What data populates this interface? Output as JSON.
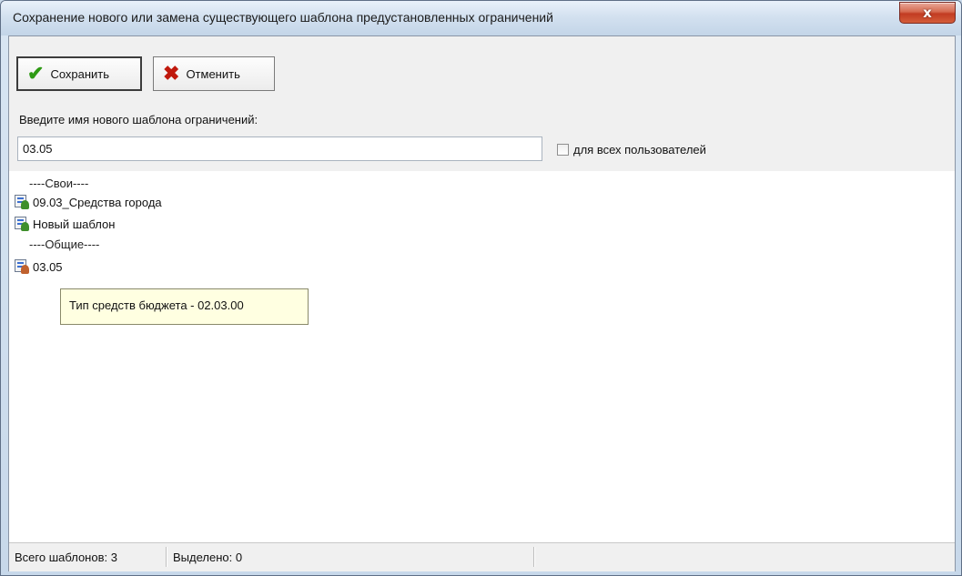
{
  "window": {
    "title": "Сохранение нового или замена существующего шаблона предустановленных ограничений",
    "close_label": "x"
  },
  "toolbar": {
    "save_label": "Сохранить",
    "cancel_label": "Отменить"
  },
  "form": {
    "prompt": "Введите имя нового шаблона ограничений:",
    "name_value": "03.05",
    "all_users_label": "для всех пользователей",
    "all_users_checked": false
  },
  "tree": {
    "own_header": "----Свои----",
    "own_items": [
      "09.03_Средства города",
      "Новый шаблон"
    ],
    "shared_header": "----Общие----",
    "shared_items": [
      "03.05"
    ]
  },
  "tooltip": {
    "text": "Тип средств бюджета  -  02.03.00"
  },
  "status": {
    "total": "Всего шаблонов: 3",
    "selected": "Выделено: 0"
  },
  "colors": {
    "accent_check": "#2e9a14",
    "accent_cross": "#c0190d",
    "close_red": "#c23b22",
    "tooltip_bg": "#ffffe1"
  }
}
